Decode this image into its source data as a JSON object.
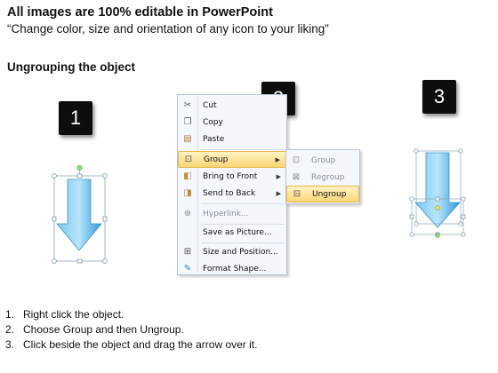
{
  "header": {
    "title": "All images are 100% editable in PowerPoint",
    "subtitle": "“Change color, size and orientation of any icon to your liking”"
  },
  "section_title": "Ungrouping the object",
  "badges": [
    "1",
    "2",
    "3"
  ],
  "context_menu": {
    "items": [
      {
        "label": "Cut",
        "icon": "scissors-icon"
      },
      {
        "label": "Copy",
        "icon": "copy-icon"
      },
      {
        "label": "Paste",
        "icon": "paste-icon"
      },
      {
        "label": "Group",
        "icon": "group-icon",
        "highlighted": true,
        "submenu": true
      },
      {
        "label": "Bring to Front",
        "icon": "bring-front-icon",
        "submenu": true
      },
      {
        "label": "Send to Back",
        "icon": "send-back-icon",
        "submenu": true
      },
      {
        "label": "Hyperlink...",
        "icon": "hyperlink-icon",
        "disabled": true
      },
      {
        "label": "Save as Picture...",
        "icon": "save-picture-icon"
      },
      {
        "label": "Size and Position...",
        "icon": "size-position-icon"
      },
      {
        "label": "Format Shape...",
        "icon": "format-shape-icon"
      }
    ]
  },
  "submenu": {
    "items": [
      {
        "label": "Group",
        "icon": "group-icon",
        "disabled": true
      },
      {
        "label": "Regroup",
        "icon": "regroup-icon",
        "disabled": true
      },
      {
        "label": "Ungroup",
        "icon": "ungroup-icon",
        "highlighted": true
      }
    ]
  },
  "steps": [
    {
      "num": "1.",
      "text": "Right click the object."
    },
    {
      "num": "2.",
      "text": "Choose Group and then Ungroup."
    },
    {
      "num": "3.",
      "text": "Click beside the object and drag the arrow over it."
    }
  ],
  "colors": {
    "arrow_light": "#a9dcf7",
    "arrow_dark": "#1f8fd3",
    "menu_highlight": "#fbd676",
    "badge": "#0d0d0d"
  }
}
